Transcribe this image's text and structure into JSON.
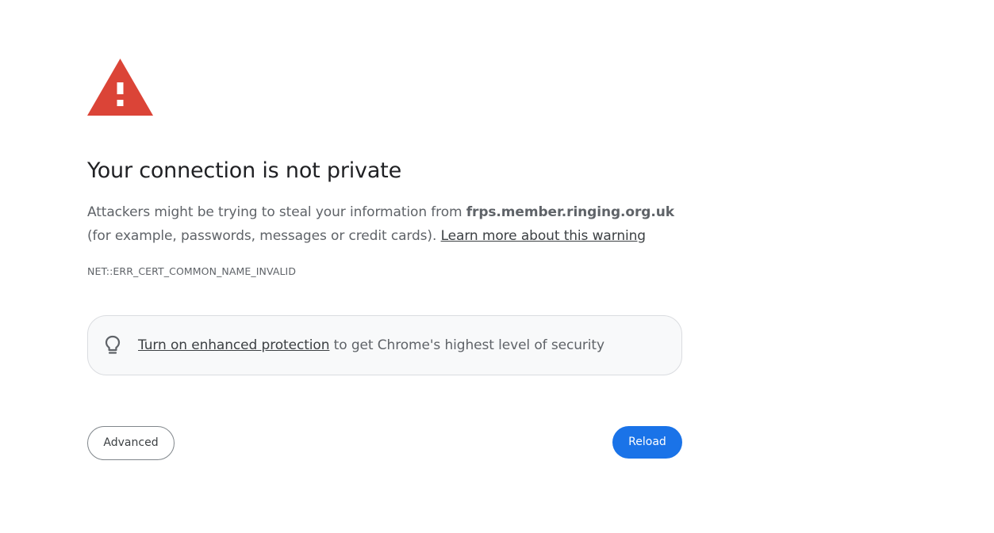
{
  "interstitial": {
    "icon": "warning-triangle-icon",
    "icon_color": "#db4437",
    "title": "Your connection is not private",
    "explanation": {
      "prefix": "Attackers might be trying to steal your information from ",
      "host": "frps.member.ringing.org.uk",
      "suffix": " (for example, passwords, messages or credit cards). ",
      "learn_more_link": "Learn more about this warning"
    },
    "error_code": "NET::ERR_CERT_COMMON_NAME_INVALID"
  },
  "enhanced_protection": {
    "icon": "lightbulb-icon",
    "link_text": "Turn on enhanced protection",
    "rest_text": " to get Chrome's highest level of security"
  },
  "buttons": {
    "advanced_label": "Advanced",
    "reload_label": "Reload",
    "reload_color": "#1a73e8"
  }
}
